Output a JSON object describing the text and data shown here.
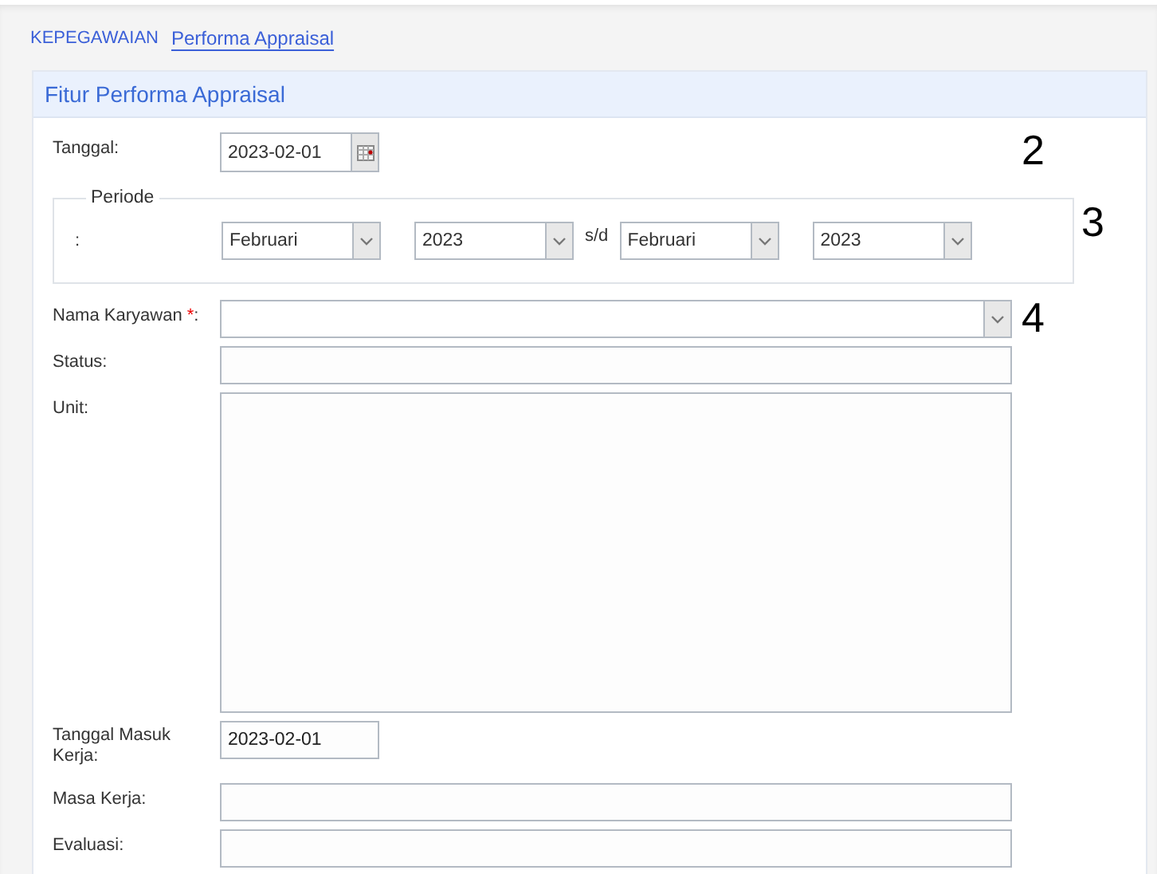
{
  "breadcrumb": [
    {
      "label": "KEPEGAWAIAN",
      "selected": false
    },
    {
      "label": "Performa Appraisal",
      "selected": true
    }
  ],
  "panel": {
    "title": "Fitur Performa Appraisal",
    "fields": [
      {
        "kind": "date",
        "label": "Tanggal:",
        "value": "2023-02-01",
        "marker": "2"
      },
      {
        "kind": "period",
        "legend": "Periode",
        "colon": ":",
        "from_month": "Februari",
        "from_year": "2023",
        "separator": "s/d",
        "to_month": "Februari",
        "to_year": "2023",
        "marker": "3"
      },
      {
        "kind": "select",
        "label": "Nama Karyawan ",
        "required_mark": "*",
        "label_end": ":",
        "marker": "4"
      },
      {
        "kind": "text",
        "label": "Status:"
      },
      {
        "kind": "textarea",
        "label": "Unit:"
      },
      {
        "kind": "short",
        "label": "Tanggal Masuk Kerja:",
        "value": "2023-02-01"
      },
      {
        "kind": "text",
        "label": "Masa Kerja:"
      },
      {
        "kind": "text",
        "label": "Evaluasi:"
      }
    ]
  }
}
